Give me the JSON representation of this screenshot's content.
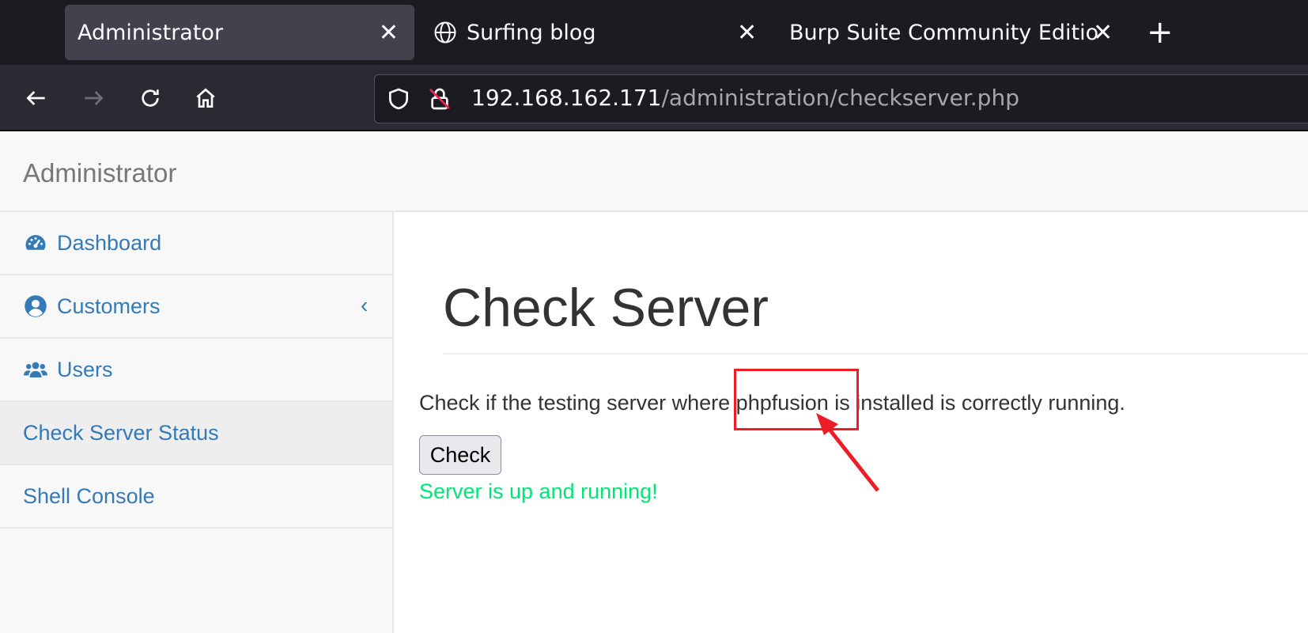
{
  "browser": {
    "tabs": [
      {
        "label": "Administrator",
        "active": true
      },
      {
        "label": "Surfing blog",
        "icon": "globe-icon"
      },
      {
        "label": "Burp Suite Community Edition"
      }
    ],
    "address": {
      "host": "192.168.162.171",
      "path": "/administration/checkserver.php"
    }
  },
  "app": {
    "brand": "Administrator",
    "sidebar": [
      {
        "label": "Dashboard",
        "icon": "dashboard-gauge-icon"
      },
      {
        "label": "Customers",
        "icon": "user-circle-icon",
        "has_submenu": true
      },
      {
        "label": "Users",
        "icon": "users-group-icon"
      },
      {
        "label": "Check Server Status",
        "active": true
      },
      {
        "label": "Shell Console"
      }
    ],
    "main": {
      "title": "Check Server",
      "description": "Check if the testing server where phpfusion is installed is correctly running.",
      "button": "Check",
      "status": "Server is up and running!"
    }
  },
  "colors": {
    "link": "#337ab7",
    "status": "#00e676",
    "annotation": "#ee1c25"
  }
}
